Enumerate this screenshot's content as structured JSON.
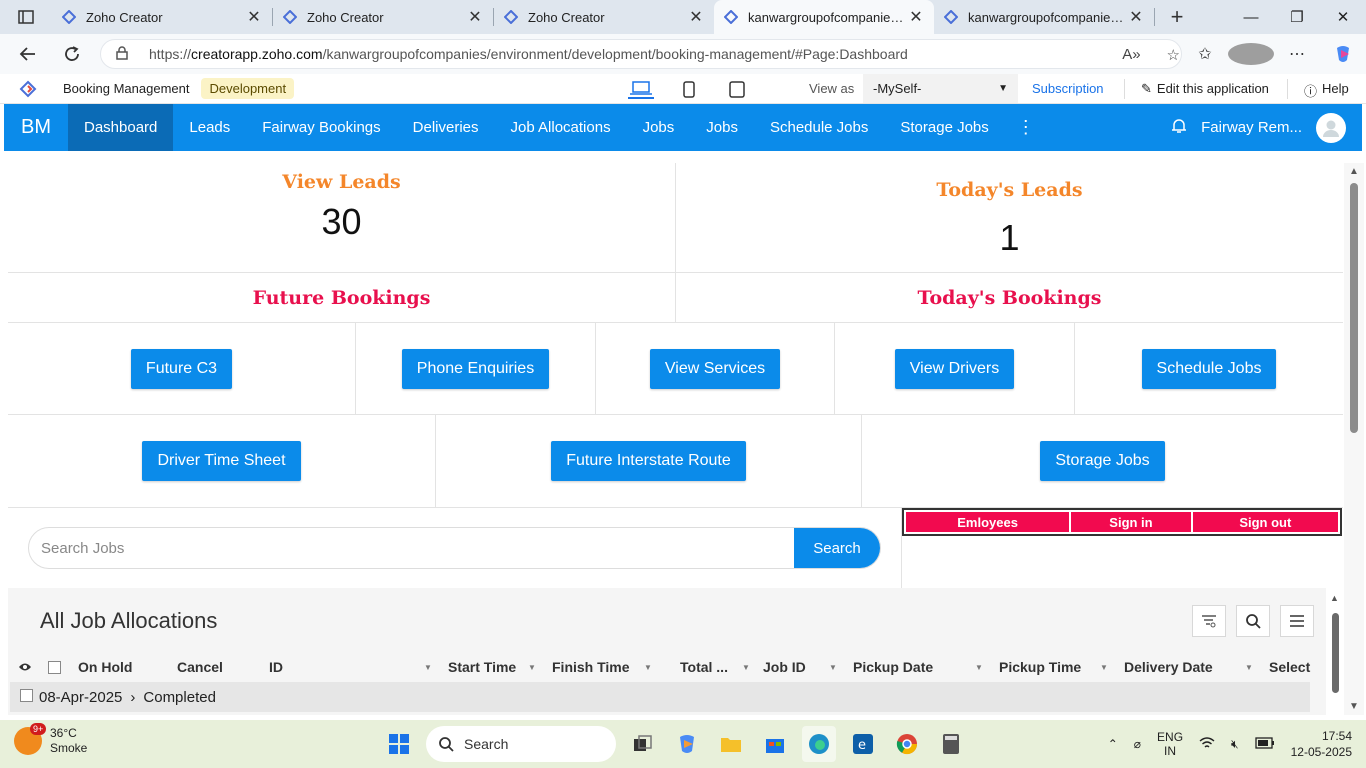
{
  "browser": {
    "tabs": [
      {
        "title": "Zoho Creator",
        "active": false
      },
      {
        "title": "Zoho Creator",
        "active": false
      },
      {
        "title": "Zoho Creator",
        "active": false
      },
      {
        "title": "kanwargroupofcompanies - B",
        "active": true
      },
      {
        "title": "kanwargroupofcompanies - B",
        "active": false
      }
    ],
    "url_prefix": "https://",
    "url_host": "creatorapp.zoho.com",
    "url_path": "/kanwargroupofcompanies/environment/development/booking-management/#Page:Dashboard"
  },
  "creator_header": {
    "app_name": "Booking Management",
    "environment": "Development",
    "view_as_label": "View as",
    "view_as_value": "-MySelf-",
    "subscription": "Subscription",
    "edit_app": "Edit this application",
    "help": "Help"
  },
  "nav": {
    "brand": "BM",
    "items": [
      "Dashboard",
      "Leads",
      "Fairway Bookings",
      "Deliveries",
      "Job Allocations",
      "Jobs",
      "Jobs",
      "Schedule Jobs",
      "Storage Jobs"
    ],
    "active": "Dashboard",
    "user_name": "Fairway Rem..."
  },
  "dashboard": {
    "view_leads_title": "View Leads",
    "view_leads_value": "30",
    "todays_leads_title": "Today's Leads",
    "todays_leads_value": "1",
    "future_bookings_title": "Future Bookings",
    "todays_bookings_title": "Today's Bookings",
    "buttons_row1": [
      "Future C3",
      "Phone Enquiries",
      "View Services",
      "View Drivers",
      "Schedule Jobs"
    ],
    "buttons_row2": [
      "Driver Time Sheet",
      "Future Interstate Route",
      "Storage Jobs"
    ],
    "search_placeholder": "Search Jobs",
    "search_button": "Search",
    "employee_table_headers": [
      "Emloyees",
      "Sign in",
      "Sign out"
    ]
  },
  "report": {
    "title": "All Job Allocations",
    "columns": [
      "On Hold",
      "Cancel",
      "ID",
      "Start Time",
      "Finish Time",
      "Total ...",
      "Job ID",
      "Pickup Date",
      "Pickup Time",
      "Delivery Date",
      "Select"
    ],
    "group_row": {
      "date": "08-Apr-2025",
      "status": "Completed"
    }
  },
  "taskbar": {
    "temperature": "36°C",
    "weather": "Smoke",
    "weather_badge": "9+",
    "search_label": "Search",
    "lang_line1": "ENG",
    "lang_line2": "IN",
    "time": "17:54",
    "date": "12-05-2025"
  },
  "colors": {
    "nav_blue": "#0b8bea",
    "nav_active": "#0b6bb6",
    "orange_title": "#f4862a",
    "red_title": "#e8104d",
    "employee_header": "#f20a4f"
  }
}
